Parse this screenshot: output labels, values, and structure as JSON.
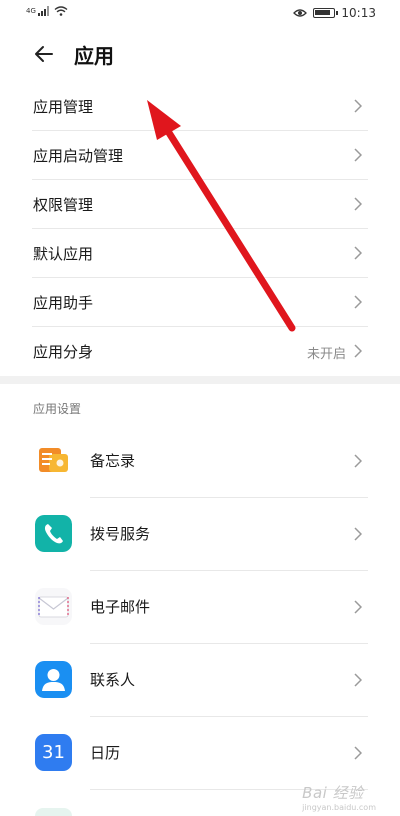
{
  "status_bar": {
    "network": "4G",
    "time": "10:13",
    "battery_level": 0.9
  },
  "header": {
    "title": "应用"
  },
  "menu_items": [
    {
      "label": "应用管理",
      "value": ""
    },
    {
      "label": "应用启动管理",
      "value": ""
    },
    {
      "label": "权限管理",
      "value": ""
    },
    {
      "label": "默认应用",
      "value": ""
    },
    {
      "label": "应用助手",
      "value": ""
    },
    {
      "label": "应用分身",
      "value": "未开启"
    }
  ],
  "settings_section": {
    "title": "应用设置",
    "apps": [
      {
        "label": "备忘录",
        "icon": "notepad-icon"
      },
      {
        "label": "拨号服务",
        "icon": "phone-icon"
      },
      {
        "label": "电子邮件",
        "icon": "envelope-icon"
      },
      {
        "label": "联系人",
        "icon": "contact-icon"
      },
      {
        "label": "日历",
        "icon": "calendar-icon",
        "icon_text": "31"
      }
    ]
  },
  "watermark": {
    "text": "Bai 经验",
    "sub": "jingyan.baidu.com"
  },
  "colors": {
    "annotation_arrow": "#e0161d",
    "notepad": "#f28c28",
    "phone": "#12b3a8",
    "contact": "#1a8ff2",
    "calendar": "#2f7cf0"
  }
}
